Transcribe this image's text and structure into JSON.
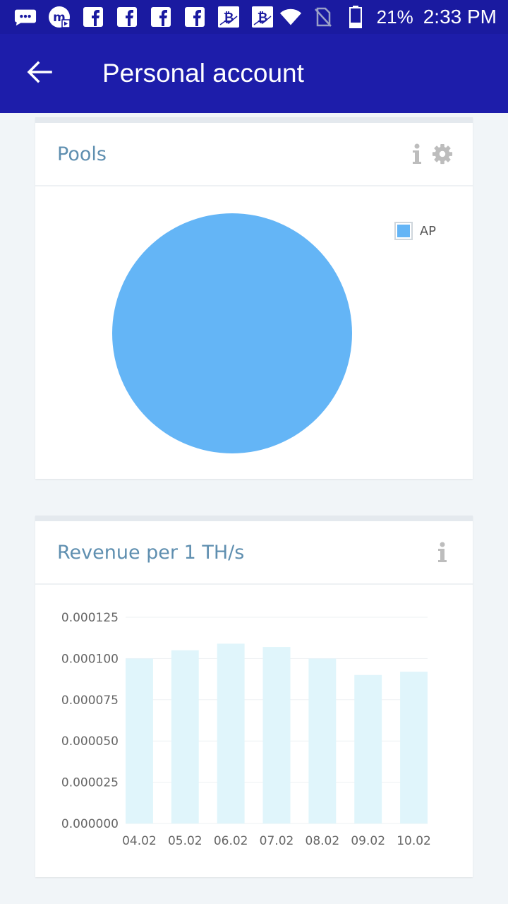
{
  "status_bar": {
    "battery": "21%",
    "time": "2:33 PM",
    "icons": [
      "chat-icon",
      "media-icon",
      "facebook-icon",
      "facebook-icon",
      "facebook-icon",
      "facebook-icon",
      "bitcoin-icon",
      "bitcoin-icon",
      "wifi-icon",
      "no-sim-icon",
      "battery-icon"
    ]
  },
  "app_bar": {
    "title": "Personal account",
    "back_icon": "arrow-back-icon"
  },
  "pools_card": {
    "title": "Pools",
    "info_icon": "info-icon",
    "settings_icon": "gear-icon",
    "legend": [
      {
        "label": "AP",
        "color": "#64b5f6"
      }
    ]
  },
  "revenue_card": {
    "title": "Revenue per 1 TH/s",
    "info_icon": "info-icon"
  },
  "chart_data": [
    {
      "type": "pie",
      "title": "Pools",
      "slices": [
        {
          "label": "AP",
          "value": 100,
          "color": "#64b5f6"
        }
      ]
    },
    {
      "type": "bar",
      "title": "Revenue per 1 TH/s",
      "categories": [
        "04.02",
        "05.02",
        "06.02",
        "07.02",
        "08.02",
        "09.02",
        "10.02"
      ],
      "values": [
        0.0001,
        0.000105,
        0.000109,
        0.000107,
        0.0001,
        9e-05,
        9.2e-05
      ],
      "ylim": [
        0,
        0.000125
      ],
      "yticks": [
        "0.000000",
        "0.000025",
        "0.000050",
        "0.000075",
        "0.000100",
        "0.000125"
      ],
      "ytick_values": [
        0,
        2.5e-05,
        5e-05,
        7.5e-05,
        0.0001,
        0.000125
      ],
      "bar_color": "#e0f5fb",
      "grid": true
    }
  ]
}
